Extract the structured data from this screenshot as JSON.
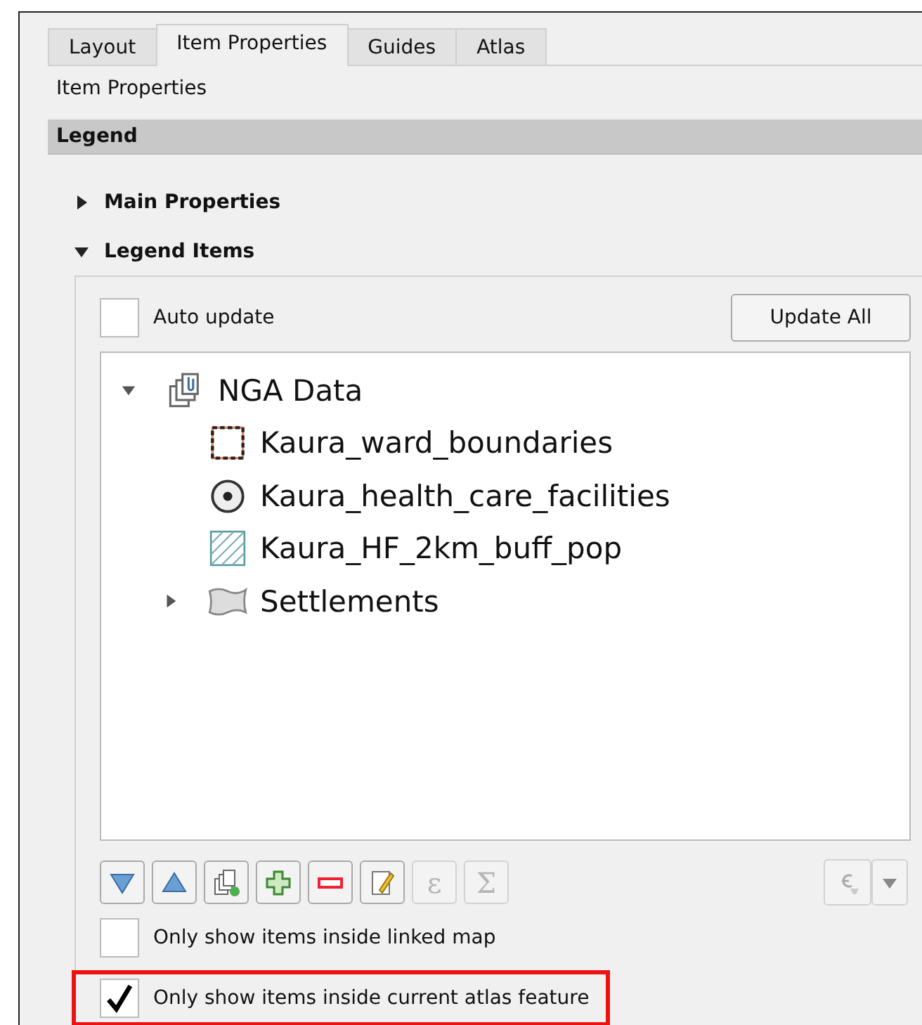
{
  "tabs": [
    {
      "label": "Layout",
      "selected": false
    },
    {
      "label": "Item Properties",
      "selected": true
    },
    {
      "label": "Guides",
      "selected": false
    },
    {
      "label": "Atlas",
      "selected": false
    }
  ],
  "panel_title": "Item Properties",
  "section_header": "Legend",
  "groups": [
    {
      "label": "Main Properties",
      "expanded": false
    },
    {
      "label": "Legend Items",
      "expanded": true
    }
  ],
  "auto_update": {
    "label": "Auto update",
    "checked": false
  },
  "update_button": "Update All",
  "tree": [
    {
      "label": "NGA Data",
      "kind": "group",
      "expanded": true,
      "children": [
        {
          "label": "Kaura_ward_boundaries",
          "kind": "polygon-dashed"
        },
        {
          "label": "Kaura_health_care_facilities",
          "kind": "point"
        },
        {
          "label": "Kaura_HF_2km_buff_pop",
          "kind": "hatched"
        },
        {
          "label": "Settlements",
          "kind": "shape",
          "expanded": false
        }
      ]
    }
  ],
  "toolbar": [
    {
      "kind": "down",
      "disabled": false
    },
    {
      "kind": "up",
      "disabled": false
    },
    {
      "kind": "group",
      "disabled": false
    },
    {
      "kind": "add",
      "disabled": false
    },
    {
      "kind": "remove",
      "disabled": false
    },
    {
      "kind": "edit",
      "disabled": false
    },
    {
      "kind": "text",
      "label": "ε",
      "disabled": true
    },
    {
      "kind": "text",
      "label": "Σ",
      "disabled": true
    }
  ],
  "options": [
    {
      "label": "Only show items inside linked map",
      "checked": false,
      "highlighted": false
    },
    {
      "label": "Only show items inside current atlas feature",
      "checked": true,
      "highlighted": true
    }
  ]
}
